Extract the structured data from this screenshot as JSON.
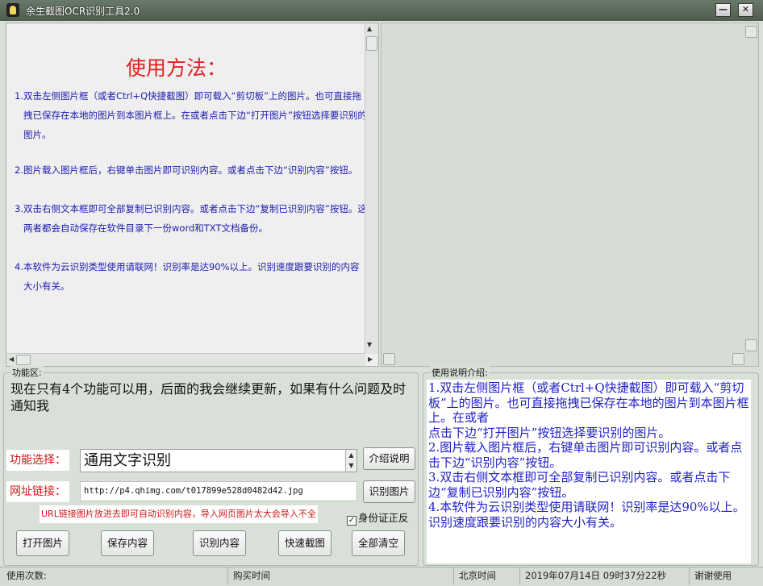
{
  "window": {
    "title": "余生截图OCR识别工具2.0",
    "minimize_label": "—",
    "close_label": "✕"
  },
  "usage": {
    "title": "使用方法：",
    "items": [
      "1.双击左侧图片框（或者Ctrl+Q快捷截图）即可载入“剪切板”上的图片。也可直接拖拽已保存在本地的图片到本图片框上。在或者点击下边“打开图片”按钮选择要识别的图片。",
      "2.图片载入图片框后，右键单击图片即可识别内容。或者点击下边“识别内容”按钮。",
      "3.双击右侧文本框即可全部复制已识别内容。或者点击下边“复制已识别内容”按钮。这两者都会自动保存在软件目录下一份word和TXT文档备份。",
      "4.本软件为云识别类型使用请联网！识别率是达90%以上。识别速度跟要识别的内容大小有关。"
    ]
  },
  "func_group": {
    "label": "功能区:",
    "notice": "现在只有4个功能可以用，后面的我会继续更新，如果有什么问题及时通知我",
    "select_label": "功能选择：",
    "select_value": "通用文字识别",
    "intro_button": "介绍说明",
    "url_label": "网址链接：",
    "url_value": "http://p4.qhimg.com/t017899e528d0482d42.jpg",
    "recognize_image_button": "识别图片",
    "hint": "URL链接图片放进去即可自动识别内容，导入网页图片太大会导入不全",
    "id_checkbox_label": "身份证正反",
    "id_checked": true,
    "buttons": [
      "打开图片",
      "保存内容",
      "识别内容",
      "快速截图",
      "全部清空"
    ]
  },
  "desc_group": {
    "label": "使用说明介绍:",
    "lines": [
      "1.双击左侧图片框（或者Ctrl+Q快捷截图）即可载入“剪切板”上的图片。也可直接拖拽已保存在本地的图片到本图片框上。在或者",
      "点击下边“打开图片”按钮选择要识别的图片。",
      "2.图片载入图片框后，右键单击图片即可识别内容。或者点击下边“识别内容”按钮。",
      "3.双击右侧文本框即可全部复制已识别内容。或者点击下边“复制已识别内容”按钮。",
      "4.本软件为云识别类型使用请联网！识别率是达90%以上。识别速度跟要识别的内容大小有关。"
    ]
  },
  "statusbar": {
    "usage_count": "使用次数:",
    "purchase_time": "购买时间",
    "beijing_time": "北京时间",
    "datetime": "2019年07月14日  09时37分22秒",
    "thanks": "谢谢使用"
  }
}
